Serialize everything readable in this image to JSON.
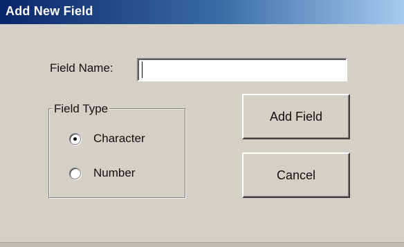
{
  "window": {
    "title": "Add New Field"
  },
  "form": {
    "field_name_label": "Field Name:",
    "field_name_value": "",
    "field_type": {
      "legend": "Field Type",
      "options": [
        {
          "label": "Character",
          "selected": true
        },
        {
          "label": "Number",
          "selected": false
        }
      ]
    }
  },
  "buttons": {
    "add_label": "Add Field",
    "cancel_label": "Cancel"
  }
}
